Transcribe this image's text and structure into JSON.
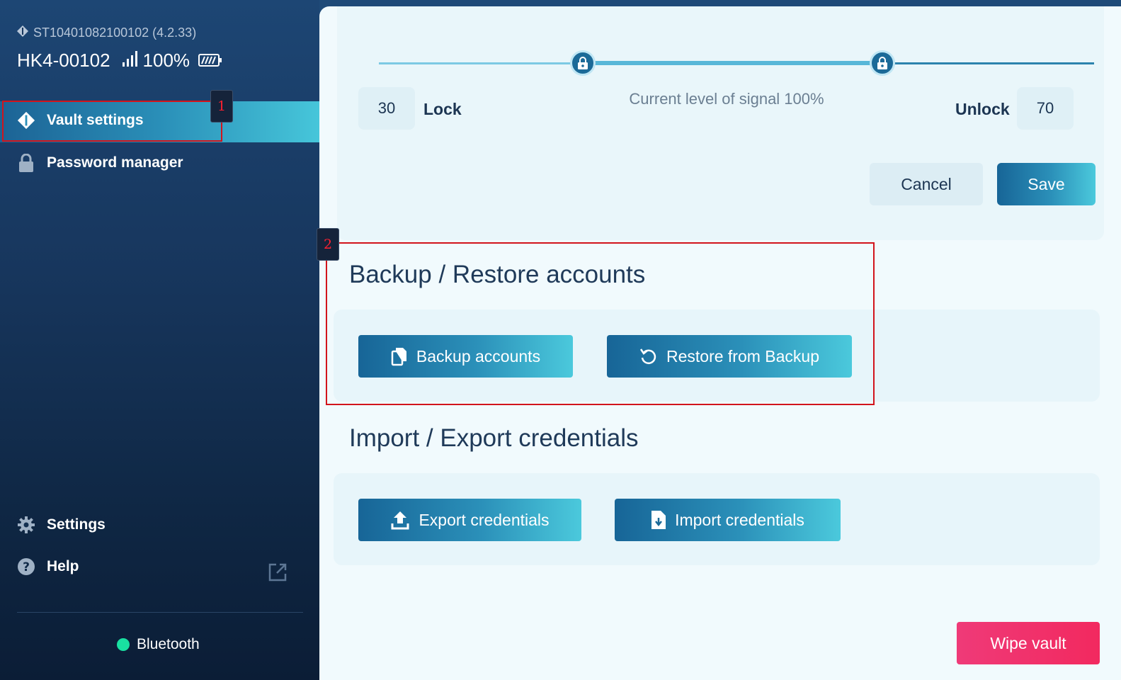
{
  "device": {
    "serial": "ST10401082100102 (4.2.33)",
    "name": "HK4-00102",
    "battery_text": "100%",
    "battery_level": 1.0
  },
  "sidebar": {
    "items": [
      {
        "label": "Vault settings",
        "icon": "vault-diamond-icon",
        "active": true
      },
      {
        "label": "Password manager",
        "icon": "lock-icon",
        "active": false
      }
    ],
    "bottom": [
      {
        "label": "Settings",
        "icon": "gear-icon"
      },
      {
        "label": "Help",
        "icon": "help-circle-icon"
      }
    ],
    "bluetooth_label": "Bluetooth",
    "bluetooth_status_color": "#19e0a1"
  },
  "annotations": [
    "1",
    "2"
  ],
  "signal": {
    "lock_value": "30",
    "lock_label": "Lock",
    "unlock_value": "70",
    "unlock_label": "Unlock",
    "current_text": "Current level of signal 100%",
    "lock_fraction": 0.3,
    "unlock_fraction": 0.7
  },
  "actions": {
    "cancel_label": "Cancel",
    "save_label": "Save"
  },
  "backup": {
    "title": "Backup / Restore accounts",
    "backup_label": "Backup accounts",
    "restore_label": "Restore from Backup"
  },
  "credentials": {
    "title": "Import / Export credentials",
    "export_label": "Export credentials",
    "import_label": "Import credentials"
  },
  "danger": {
    "wipe_label": "Wipe vault",
    "color": "#f2295f"
  },
  "colors": {
    "accent": "#2b90b9",
    "sidebar_bg": "#17365d"
  }
}
